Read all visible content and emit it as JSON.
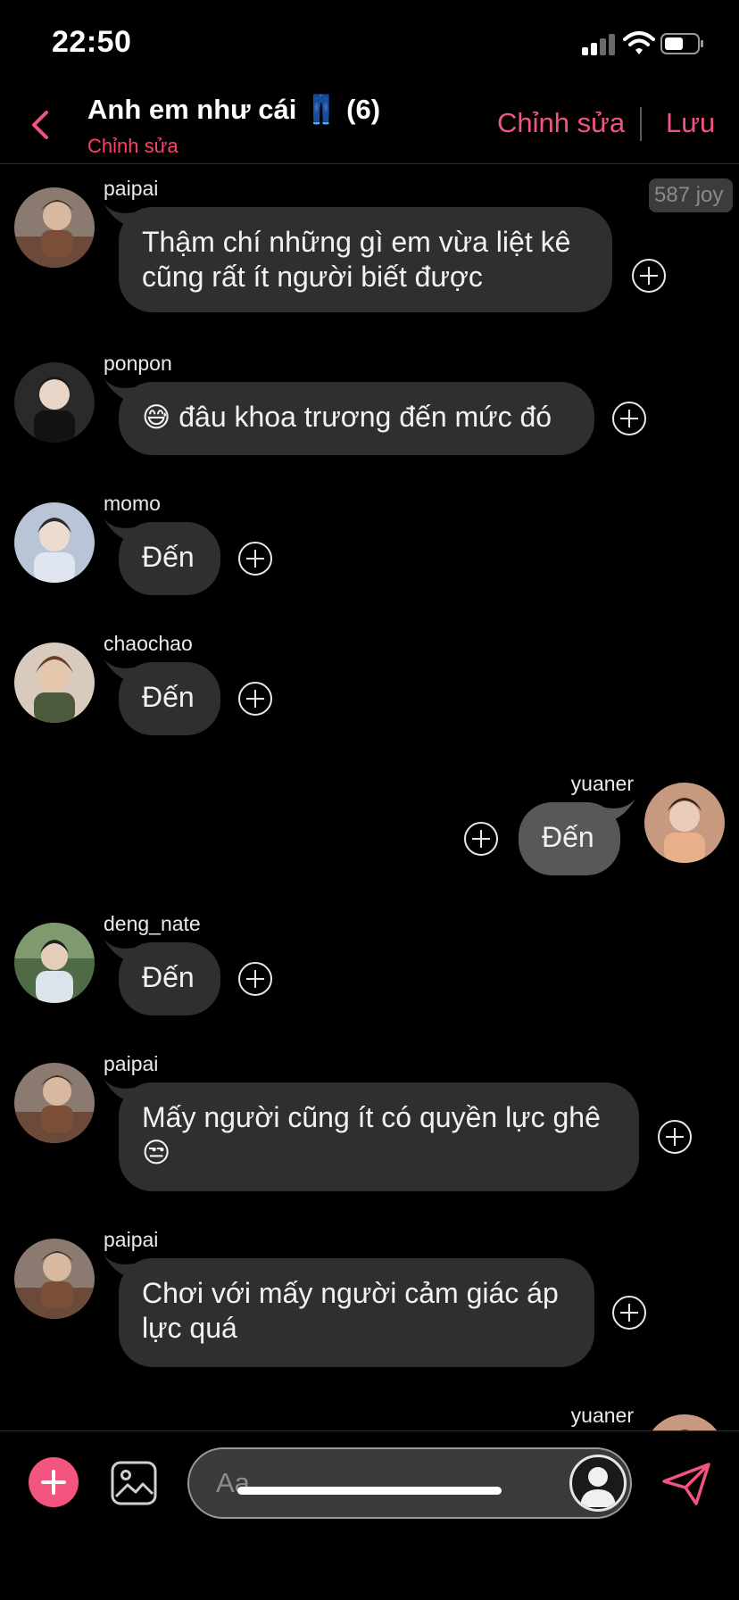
{
  "status": {
    "time": "22:50"
  },
  "header": {
    "title": "Anh em như cái 👖 (6)",
    "subtitle": "Chỉnh sửa",
    "edit_label": "Chỉnh sửa",
    "save_label": "Lưu"
  },
  "joy_badge": "587 joy",
  "messages": [
    {
      "user": "paipai",
      "side": "left",
      "text": "Thậm chí những gì em vừa liệt kê cũng rất ít người biết được"
    },
    {
      "user": "ponpon",
      "side": "left",
      "text": "đâu khoa trương đến mức đó",
      "emoji": "😅"
    },
    {
      "user": "momo",
      "side": "left",
      "text": "Đến"
    },
    {
      "user": "chaochao",
      "side": "left",
      "text": "Đến"
    },
    {
      "user": "yuaner",
      "side": "right",
      "text": "Đến"
    },
    {
      "user": "deng_nate",
      "side": "left",
      "text": "Đến"
    },
    {
      "user": "paipai",
      "side": "left",
      "text": "Mấy người cũng ít có quyền lực ghê",
      "emoji": "😒"
    },
    {
      "user": "paipai",
      "side": "left",
      "text": "Chơi với mấy người cảm giác áp lực quá"
    },
    {
      "user": "yuaner",
      "side": "right",
      "text": ""
    }
  ],
  "input": {
    "placeholder": "Aa"
  },
  "icons": {
    "back": "chevron-left-icon",
    "add": "plus-circle-icon",
    "image": "image-icon",
    "profile": "user-silhouette-icon",
    "send": "paper-plane-icon",
    "react": "plus-circle-outline-icon"
  },
  "colors": {
    "accent": "#f2547f",
    "subtitle": "#ff4163",
    "bubble_other": "#2f2f2f",
    "bubble_me": "#585858",
    "background": "#000000"
  }
}
